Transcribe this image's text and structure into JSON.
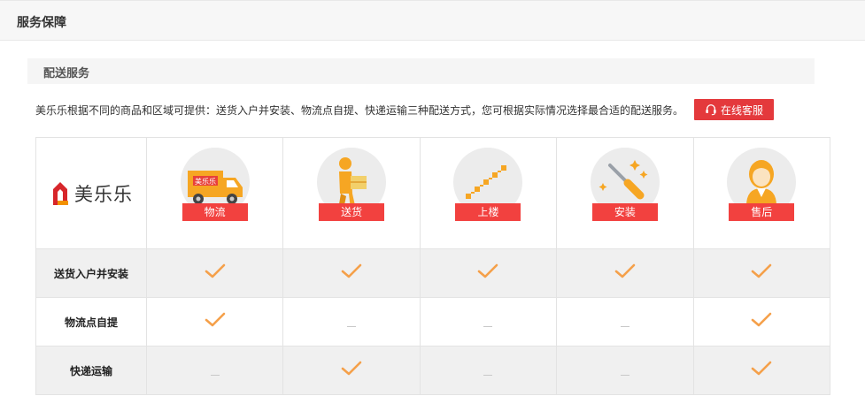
{
  "header": {
    "title": "服务保障"
  },
  "section": {
    "title": "配送服务"
  },
  "intro": {
    "text": "美乐乐根据不同的商品和区域可提供：送货入户并安装、物流点自提、快递运输三种配送方式，您可根据实际情况选择最合适的配送服务。"
  },
  "service_button": {
    "label": "在线客服",
    "icon": "headset-icon"
  },
  "brand": {
    "name": "美乐乐",
    "icon": "meilele-logo-icon"
  },
  "columns": [
    {
      "label": "物流",
      "icon": "truck-icon"
    },
    {
      "label": "送货",
      "icon": "delivery-man-icon"
    },
    {
      "label": "上楼",
      "icon": "stairs-icon"
    },
    {
      "label": "安装",
      "icon": "screwdriver-icon"
    },
    {
      "label": "售后",
      "icon": "support-agent-icon"
    }
  ],
  "rows": [
    {
      "label": "送货入户并安装",
      "values": [
        true,
        true,
        true,
        true,
        true
      ]
    },
    {
      "label": "物流点自提",
      "values": [
        true,
        false,
        false,
        false,
        true
      ]
    },
    {
      "label": "快递运输",
      "values": [
        false,
        true,
        false,
        false,
        true
      ]
    }
  ],
  "colors": {
    "accent": "#e4393c",
    "tag": "#f2413f",
    "icon": "#f6a623",
    "check": "#f5a04a"
  }
}
